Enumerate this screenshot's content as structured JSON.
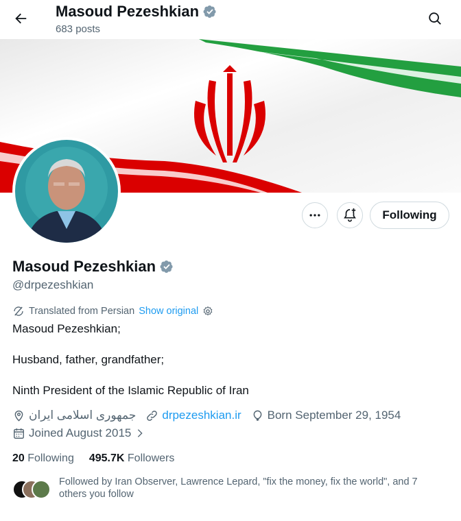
{
  "header": {
    "title": "Masoud Pezeshkian",
    "posts": "683 posts"
  },
  "profile": {
    "name": "Masoud Pezeshkian",
    "handle": "@drpezeshkian",
    "following_button": "Following",
    "translated_label": "Translated from Persian",
    "show_original": "Show original",
    "bio": [
      "Masoud Pezeshkian;",
      "Husband, father, grandfather;",
      "Ninth President of the Islamic Republic of Iran"
    ],
    "location": "جمهوری اسلامی ایران",
    "website": "drpezeshkian.ir",
    "born": "Born September 29, 1954",
    "joined": "Joined August 2015",
    "following_count": "20",
    "following_label": "Following",
    "followers_count": "495.7K",
    "followers_label": "Followers",
    "followed_by": "Followed by Iran Observer, Lawrence Lepard, \"fix the money, fix the world\", and 7 others you follow"
  },
  "colors": {
    "accent": "#1d9bf0",
    "verified": "#829aab",
    "flag_green": "#239f40",
    "flag_red": "#da0000"
  },
  "icons": [
    "back-arrow-icon",
    "search-icon",
    "more-icon",
    "notification-bell-icon",
    "verified-badge-icon",
    "translate-icon",
    "gear-icon",
    "location-icon",
    "link-icon",
    "balloon-icon",
    "calendar-icon",
    "chevron-right-icon"
  ]
}
